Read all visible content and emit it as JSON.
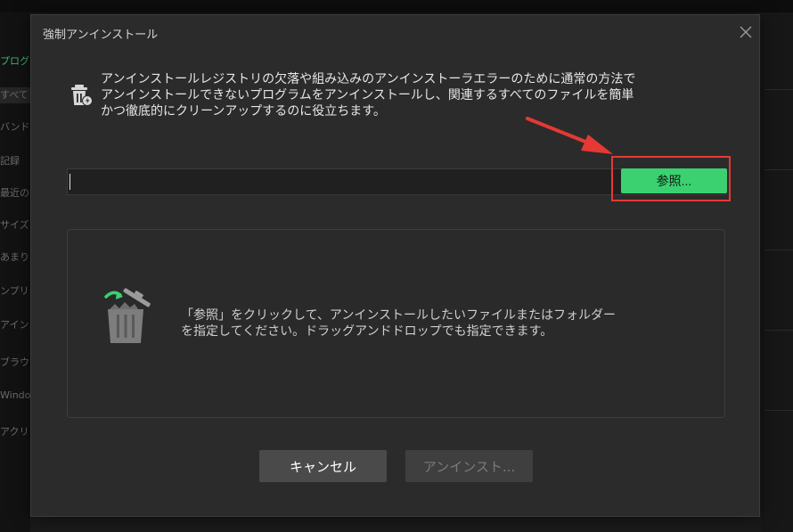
{
  "background": {
    "sidebar_items": [
      "プログ",
      "すべて",
      "バンド",
      "記録",
      "最近の",
      "サイズ",
      "あまり",
      "ンプリ",
      "アインス",
      "ブラウ",
      "Windo",
      "アクリ"
    ]
  },
  "dialog": {
    "title": "強制アンインストール",
    "description_lines": [
      "アンインストールレジストリの欠落や組み込みのアンインストーラエラーのために通常の方法で",
      "アンインストールできないプログラムをアンインストールし、関連するすべてのファイルを簡単",
      "かつ徹底的にクリーンアップするのに役立ちます。"
    ],
    "path_input": {
      "value": "",
      "placeholder": ""
    },
    "browse_label": "参照...",
    "drop_hint_lines": [
      "「参照」をクリックして、アンインストールしたいファイルまたはフォルダー",
      "を指定してください。ドラッグアンドドロップでも指定できます。"
    ],
    "cancel_label": "キャンセル",
    "uninstall_label": "アンインスト..."
  },
  "colors": {
    "accent": "#3bd171",
    "highlight": "#e53935",
    "dialog_bg": "#2b2b2b"
  },
  "icons": {
    "close": "close-icon",
    "info": "trash-bolt-icon",
    "drop": "trash-can-icon",
    "annotation": "red-arrow-icon"
  }
}
